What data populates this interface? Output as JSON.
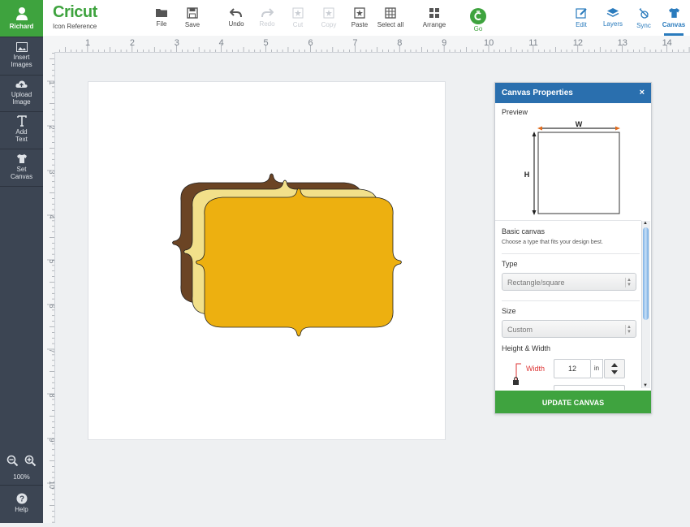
{
  "sidebar": {
    "user": "Richard",
    "items": [
      {
        "line1": "Insert",
        "line2": "Images"
      },
      {
        "line1": "Upload",
        "line2": "Image"
      },
      {
        "line1": "Add",
        "line2": "Text"
      },
      {
        "line1": "Set",
        "line2": "Canvas"
      }
    ],
    "zoom": "100%",
    "help": "Help"
  },
  "toolbar": {
    "logo": "Cricut",
    "logo_sub": "Icon Reference",
    "file": "File",
    "save": "Save",
    "undo": "Undo",
    "redo": "Redo",
    "cut": "Cut",
    "copy": "Copy",
    "paste": "Paste",
    "select_all": "Select all",
    "arrange": "Arrange",
    "go": "Go",
    "edit": "Edit",
    "layers": "Layers",
    "sync": "Sync",
    "canvas": "Canvas"
  },
  "rulers": {
    "h": [
      "1",
      "2",
      "3",
      "4",
      "5",
      "6",
      "7",
      "8",
      "9",
      "10",
      "11",
      "12",
      "13",
      "14"
    ],
    "v": [
      "1",
      "2",
      "3",
      "4",
      "5",
      "6",
      "7",
      "8",
      "9",
      "10"
    ]
  },
  "panel": {
    "title": "Canvas Properties",
    "close": "×",
    "preview": "Preview",
    "preview_w": "W",
    "preview_h": "H",
    "basic_title": "Basic canvas",
    "basic_desc": "Choose a type that fits your design best.",
    "type_label": "Type",
    "type_value": "Rectangle/square",
    "size_label": "Size",
    "size_value": "Custom",
    "hw_label": "Height & Width",
    "width_label": "Width",
    "width_value": "12",
    "unit": "in",
    "update": "UPDATE CANVAS"
  },
  "colors": {
    "sidebar": "#3c4553",
    "green": "#3ea33e",
    "blue": "#2a6fae",
    "shape_back": "#6b4424",
    "shape_mid": "#f2e08a",
    "shape_front": "#edb010"
  }
}
